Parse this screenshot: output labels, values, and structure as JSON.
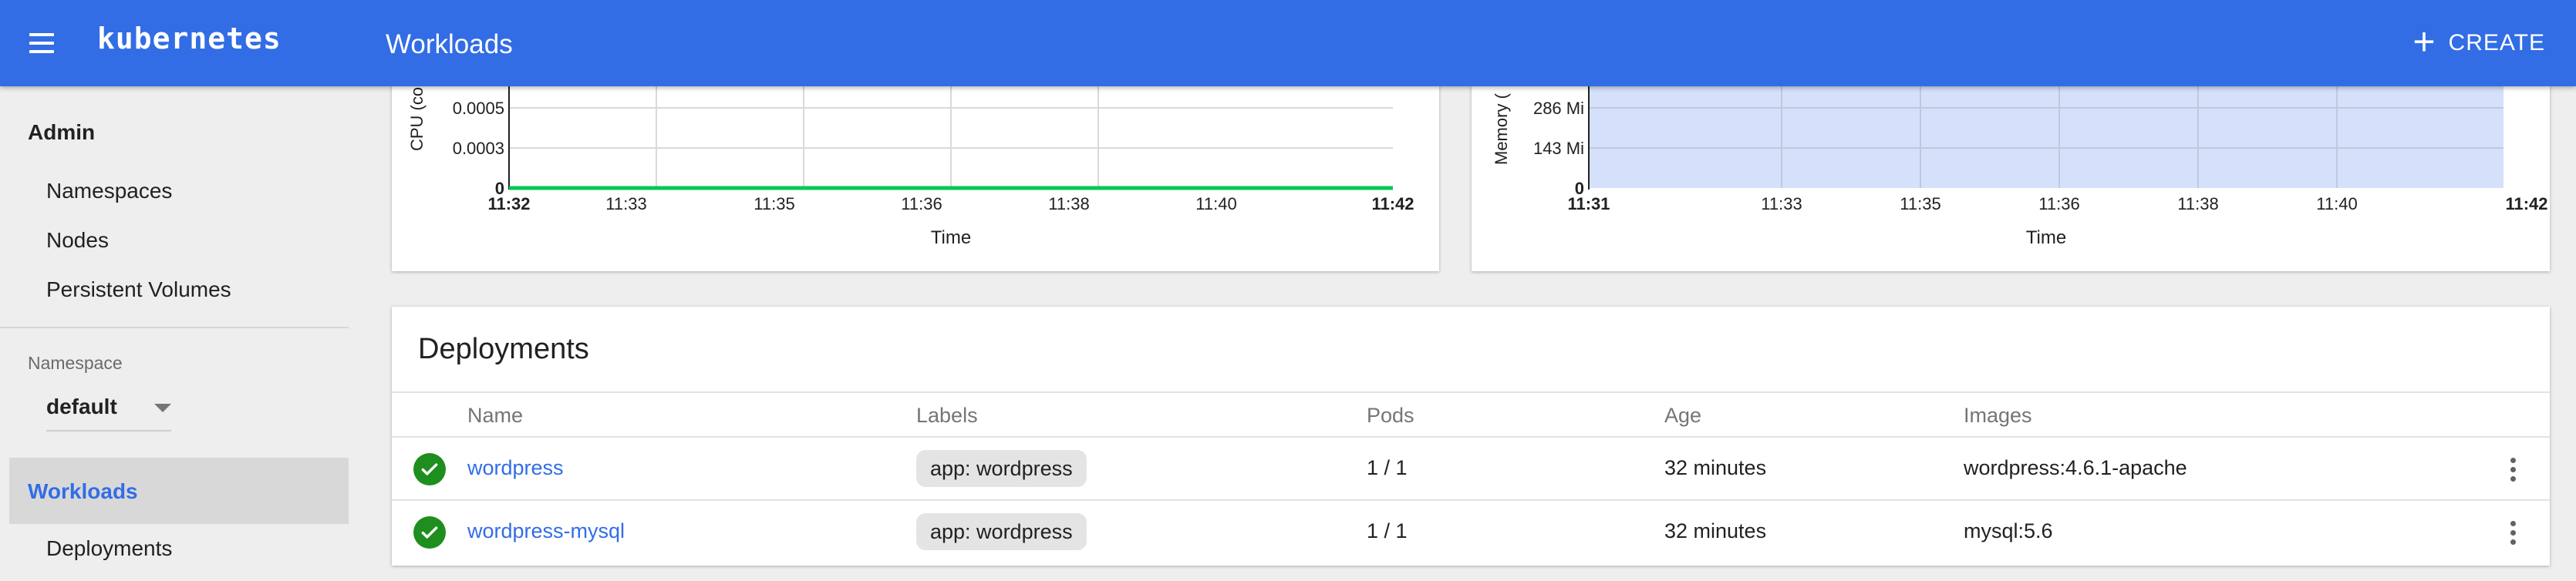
{
  "topbar": {
    "brand": "kubernetes",
    "page_title": "Workloads",
    "create_label": "CREATE"
  },
  "sidebar": {
    "admin_heading": "Admin",
    "admin_items": [
      "Namespaces",
      "Nodes",
      "Persistent Volumes"
    ],
    "namespace_label": "Namespace",
    "namespace_value": "default",
    "workloads_label": "Workloads",
    "workloads_items": [
      "Deployments"
    ]
  },
  "cpu_chart": {
    "ylabel": "CPU (co",
    "xlabel": "Time",
    "yticks": [
      "0.0005",
      "0.0003",
      "0"
    ],
    "xticks": [
      "11:32",
      "11:33",
      "11:35",
      "11:36",
      "11:38",
      "11:40",
      "11:42"
    ],
    "series_color": "#00c853"
  },
  "mem_chart": {
    "ylabel": "Memory (",
    "xlabel": "Time",
    "yticks": [
      "286 Mi",
      "143 Mi",
      "0"
    ],
    "xticks": [
      "11:31",
      "11:33",
      "11:35",
      "11:36",
      "11:38",
      "11:40",
      "11:42"
    ],
    "fill_color": "#d5e1fa"
  },
  "chart_data": [
    {
      "type": "line",
      "ylabel": "CPU (co",
      "xlabel": "Time",
      "x": [
        "11:32",
        "11:33",
        "11:35",
        "11:36",
        "11:38",
        "11:40",
        "11:42"
      ],
      "series": [
        {
          "values": [
            0,
            0,
            0,
            0,
            0,
            0,
            0
          ]
        }
      ],
      "ylim": [
        0,
        0.0007
      ],
      "grid": true
    },
    {
      "type": "area",
      "ylabel": "Memory (",
      "xlabel": "Time",
      "x": [
        "11:31",
        "11:33",
        "11:35",
        "11:36",
        "11:38",
        "11:40",
        "11:42"
      ],
      "series": [
        {
          "values": [
            429,
            429,
            429,
            429,
            429,
            429
          ]
        }
      ],
      "ylim": [
        0,
        429
      ],
      "grid": true
    }
  ],
  "deployments": {
    "title": "Deployments",
    "headers": {
      "name": "Name",
      "labels": "Labels",
      "pods": "Pods",
      "age": "Age",
      "images": "Images"
    },
    "rows": [
      {
        "status": "check-circle-icon",
        "name": "wordpress",
        "label": "app: wordpress",
        "pods": "1 / 1",
        "age": "32 minutes",
        "images": "wordpress:4.6.1-apache"
      },
      {
        "status": "check-circle-icon",
        "name": "wordpress-mysql",
        "label": "app: wordpress",
        "pods": "1 / 1",
        "age": "32 minutes",
        "images": "mysql:5.6"
      }
    ]
  },
  "colors": {
    "primary": "#326de6",
    "success": "#1e8e1e",
    "background": "#eeeeee"
  }
}
